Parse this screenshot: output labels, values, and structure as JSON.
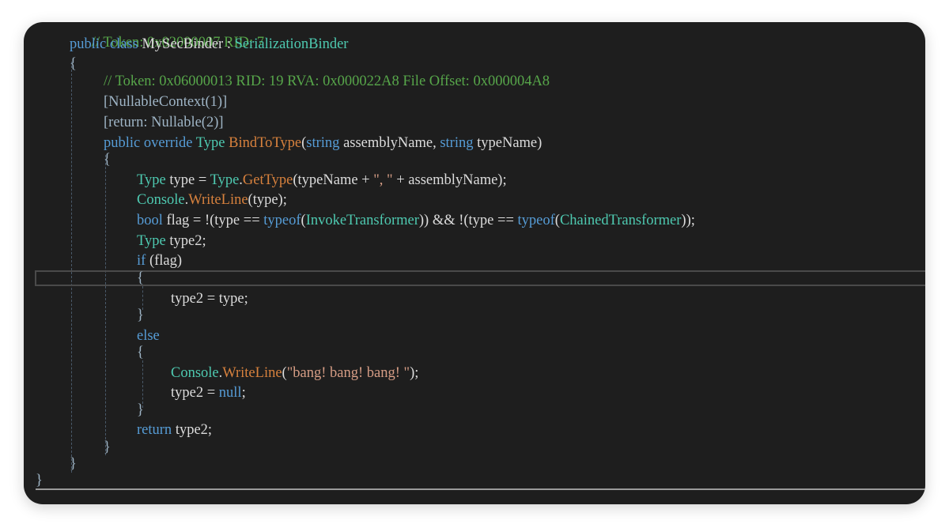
{
  "code": {
    "token_top": "// Token: 0x02000007 RID: 7",
    "class_kw": "public class",
    "class_name": "MySecBinder",
    "colon": " : ",
    "base_class": "SerializationBinder",
    "open_brace_class": "{",
    "method_comment": "// Token: 0x06000013 RID: 19 RVA: 0x000022A8 File Offset: 0x000004A8",
    "attr1": "[NullableContext(1)]",
    "attr2": "[return: Nullable(2)]",
    "sig_kw": "public override",
    "sig_type": "Type",
    "sig_name": "BindToType",
    "sig_open": "(",
    "sig_kw_string": "string",
    "sig_p1": " assemblyName, ",
    "sig_kw_string2": "string",
    "sig_p2": " typeName)",
    "open_brace_method": "{",
    "l1_type": "Type",
    "l1_a": " type = ",
    "l1_type2": "Type",
    "l1_dot": ".",
    "l1_fn": "GetType",
    "l1_b": "(typeName + ",
    "l1_str": "\", \"",
    "l1_c": " + assemblyName);",
    "l2_type": "Console",
    "l2_dot": ".",
    "l2_fn": "WriteLine",
    "l2_rest": "(type);",
    "l3_kw": "bool",
    "l3_a": " flag = !(type == ",
    "l3_kw2": "typeof",
    "l3_b": "(",
    "l3_ty": "InvokeTransformer",
    "l3_c": ")) && !(type == ",
    "l3_kw3": "typeof",
    "l3_d": "(",
    "l3_ty2": "ChainedTransformer",
    "l3_e": "));",
    "l4_type": "Type",
    "l4_rest": " type2;",
    "l5_kw": "if",
    "l5_rest": " (flag)",
    "if_open": "{",
    "l6": "type2 = type;",
    "if_close": "}",
    "else_kw": "else",
    "else_open": "{",
    "l7_type": "Console",
    "l7_dot": ".",
    "l7_fn": "WriteLine",
    "l7_a": "(",
    "l7_str": "\"bang! bang! bang! \"",
    "l7_b": ");",
    "l8_a": "type2 = ",
    "l8_kw": "null",
    "l8_b": ";",
    "else_close": "}",
    "ret_kw": "return",
    "ret_rest": " type2;",
    "close_brace_method": "}",
    "close_brace_class": "}",
    "close_brace_ns": "}"
  },
  "colors": {
    "background": "#1e1e1e",
    "keyword": "#569cd6",
    "type": "#4ec9b0",
    "method": "#d7813d",
    "comment": "#57a64a",
    "string": "#d69d85",
    "text": "#dcdcdc"
  }
}
